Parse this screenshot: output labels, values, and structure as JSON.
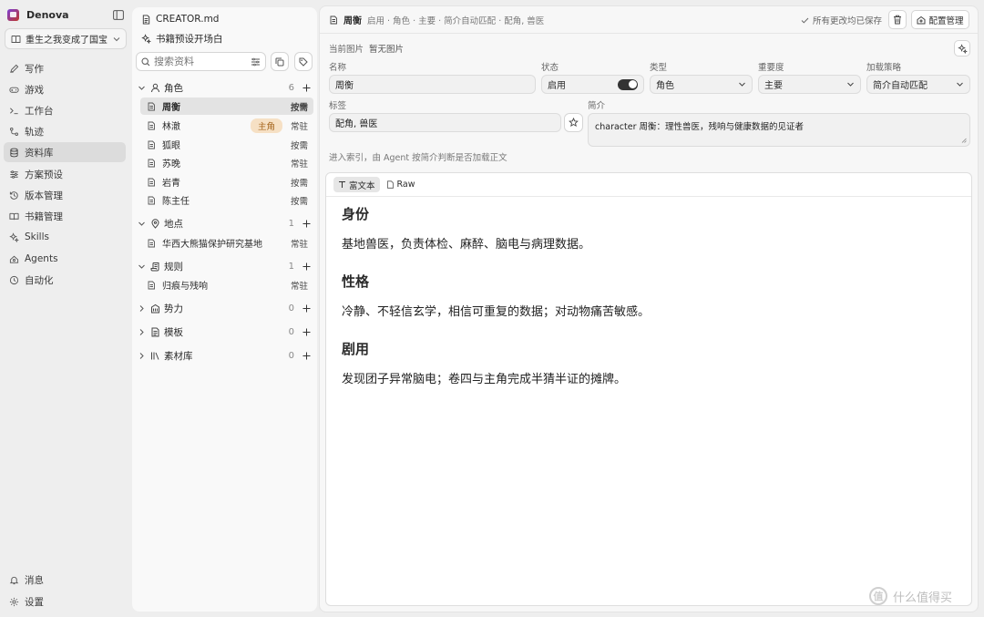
{
  "app": {
    "name": "Denova"
  },
  "book_selector": {
    "label": "重生之我变成了国宝"
  },
  "nav": {
    "items": [
      {
        "label": "写作",
        "icon": "pen-icon"
      },
      {
        "label": "游戏",
        "icon": "gamepad-icon"
      },
      {
        "label": "工作台",
        "icon": "terminal-icon"
      },
      {
        "label": "轨迹",
        "icon": "path-icon"
      },
      {
        "label": "资料库",
        "icon": "database-icon",
        "active": true
      },
      {
        "label": "方案预设",
        "icon": "sliders-icon"
      },
      {
        "label": "版本管理",
        "icon": "history-icon"
      },
      {
        "label": "书籍管理",
        "icon": "book-icon"
      },
      {
        "label": "Skills",
        "icon": "sparkles-icon"
      },
      {
        "label": "Agents",
        "icon": "agent-icon"
      },
      {
        "label": "自动化",
        "icon": "clock-icon"
      }
    ],
    "bottom": [
      {
        "label": "消息",
        "icon": "bell-icon"
      },
      {
        "label": "设置",
        "icon": "gear-icon"
      }
    ]
  },
  "tree": {
    "creator_file": "CREATOR.md",
    "preset_label": "书籍预设开场白",
    "search_placeholder": "搜索资料",
    "groups": [
      {
        "label": "角色",
        "count": "6",
        "expanded": true,
        "entries": [
          {
            "name": "周衡",
            "load": "按需",
            "active": true
          },
          {
            "name": "林澈",
            "tag": "主角",
            "load": "常驻"
          },
          {
            "name": "狐眼",
            "load": "按需"
          },
          {
            "name": "苏晚",
            "load": "常驻"
          },
          {
            "name": "岩青",
            "load": "按需"
          },
          {
            "name": "陈主任",
            "load": "按需"
          }
        ]
      },
      {
        "label": "地点",
        "count": "1",
        "expanded": true,
        "entries": [
          {
            "name": "华西大熊猫保护研究基地",
            "load": "常驻"
          }
        ]
      },
      {
        "label": "规则",
        "count": "1",
        "expanded": true,
        "entries": [
          {
            "name": "归痕与残响",
            "load": "常驻"
          }
        ]
      },
      {
        "label": "势力",
        "count": "0",
        "expanded": false,
        "entries": []
      },
      {
        "label": "模板",
        "count": "0",
        "expanded": false,
        "entries": []
      },
      {
        "label": "素材库",
        "count": "0",
        "expanded": false,
        "entries": []
      }
    ]
  },
  "editor": {
    "title": "周衡",
    "meta": "启用 · 角色 · 主要 · 简介自动匹配 · 配角, 兽医",
    "saved_text": "所有更改均已保存",
    "config_button": "配置管理",
    "image_label": "当前图片",
    "image_value": "暂无图片",
    "fields": {
      "name": {
        "label": "名称",
        "value": "周衡"
      },
      "status": {
        "label": "状态",
        "value": "启用",
        "enabled": true
      },
      "type": {
        "label": "类型",
        "value": "角色"
      },
      "importance": {
        "label": "重要度",
        "value": "主要"
      },
      "load_strategy": {
        "label": "加载策略",
        "value": "简介自动匹配"
      },
      "tags": {
        "label": "标签",
        "value": "配角, 兽医"
      },
      "summary": {
        "label": "简介",
        "value": "character 周衡：理性兽医，残响与健康数据的见证者"
      }
    },
    "hint": "进入索引，由 Agent 按简介判断是否加载正文",
    "tabs": [
      {
        "label": "富文本",
        "active": true
      },
      {
        "label": "Raw",
        "active": false
      }
    ],
    "doc": [
      {
        "heading": "身份",
        "text": "基地兽医，负责体检、麻醉、脑电与病理数据。"
      },
      {
        "heading": "性格",
        "text": "冷静、不轻信玄学，相信可重复的数据；对动物痛苦敏感。"
      },
      {
        "heading": "剧用",
        "text": "发现团子异常脑电；卷四与主角完成半猜半证的摊牌。"
      }
    ]
  },
  "watermark": {
    "symbol": "值",
    "text": "什么值得买"
  }
}
